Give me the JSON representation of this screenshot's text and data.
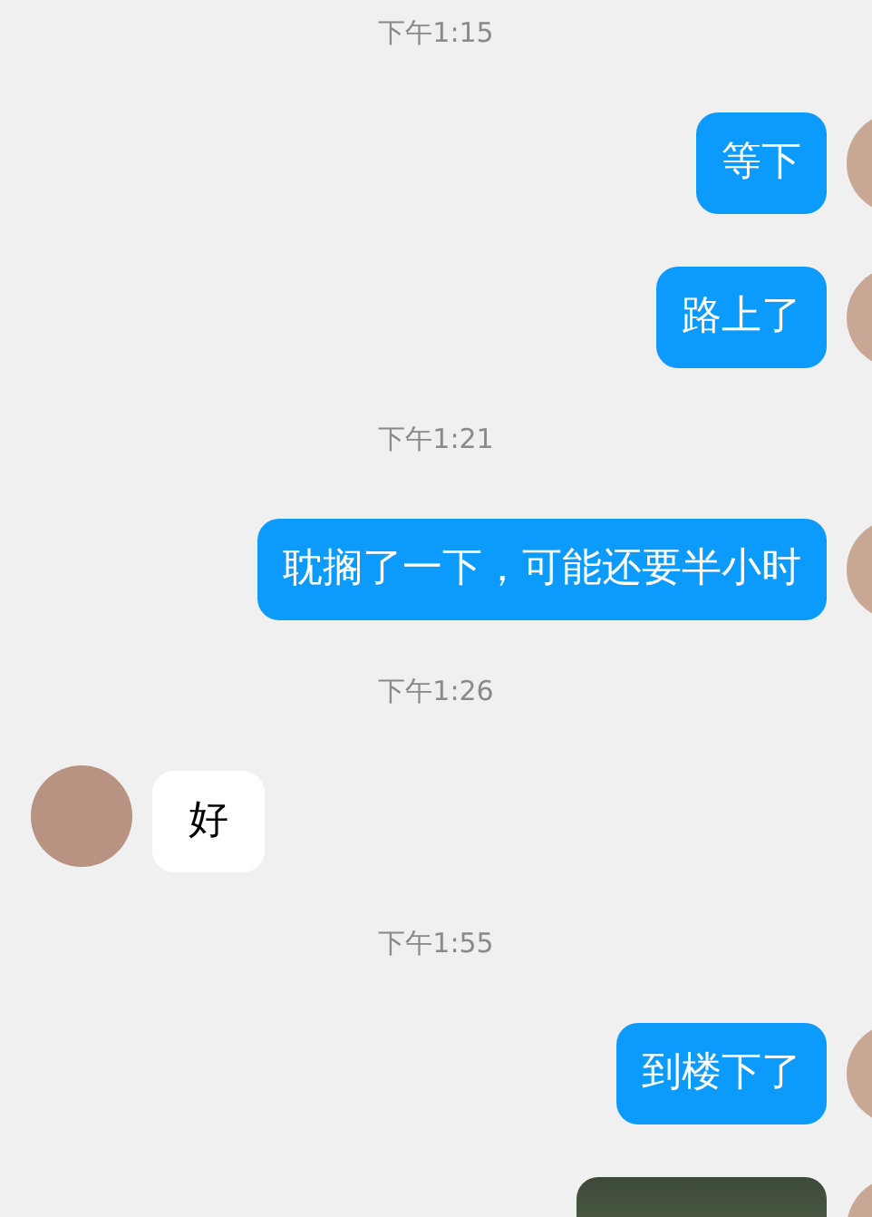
{
  "messages": [
    {
      "kind": "time",
      "text": "下午1:15"
    },
    {
      "kind": "text",
      "outgoing": true,
      "text": "等下"
    },
    {
      "kind": "text",
      "outgoing": true,
      "text": "路上了"
    },
    {
      "kind": "time",
      "text": "下午1:21"
    },
    {
      "kind": "text",
      "outgoing": true,
      "text": "耽搁了一下，可能还要半小时"
    },
    {
      "kind": "time",
      "text": "下午1:26"
    },
    {
      "kind": "text",
      "outgoing": false,
      "text": "好"
    },
    {
      "kind": "time",
      "text": "下午1:55"
    },
    {
      "kind": "text",
      "outgoing": true,
      "text": "到楼下了"
    },
    {
      "kind": "image",
      "outgoing": true
    }
  ]
}
